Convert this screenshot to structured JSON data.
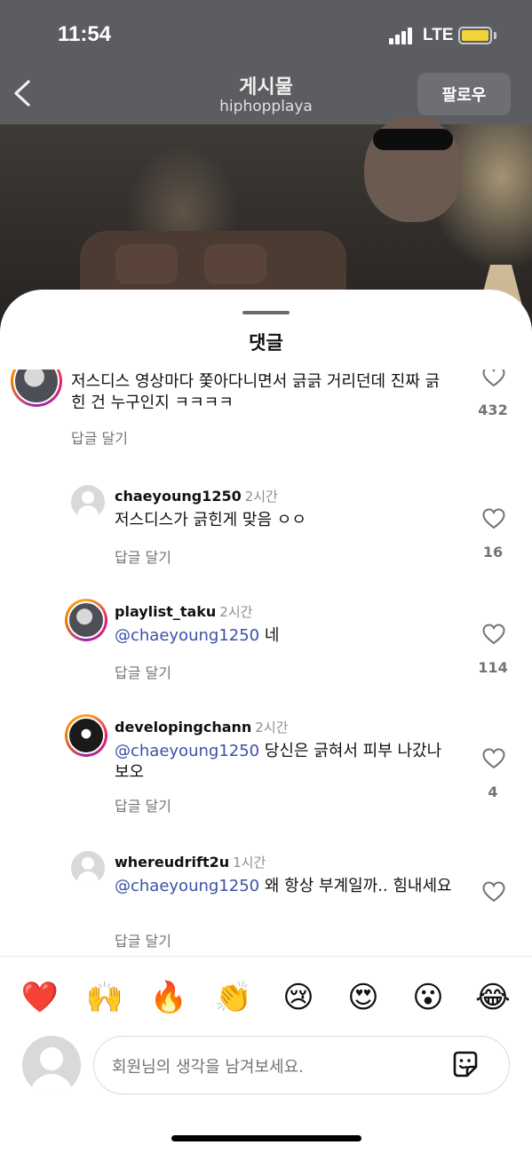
{
  "status_bar": {
    "time": "11:54",
    "network": "LTE"
  },
  "header": {
    "title": "게시물",
    "subtitle": "hiphopplaya",
    "follow_label": "팔로우"
  },
  "sheet": {
    "title": "댓글"
  },
  "comments": [
    {
      "text": "저스디스 영상마다 쫓아다니면서 긁긁 거리던데 진짜 긁힌 건 누구인지 ㅋㅋㅋㅋ",
      "reply_label": "답글 달기",
      "likes": "432"
    },
    {
      "user": "chaeyoung1250",
      "time": "2시간",
      "text": "저스디스가 긁힌게 맞음 ㅇㅇ",
      "reply_label": "답글 달기",
      "likes": "16"
    },
    {
      "user": "playlist_taku",
      "time": "2시간",
      "mention": "@chaeyoung1250",
      "text": " 네",
      "reply_label": "답글 달기",
      "likes": "114"
    },
    {
      "user": "developingchann",
      "time": "2시간",
      "mention": "@chaeyoung1250",
      "text": " 당신은 긁혀서 피부 나갔나보오",
      "reply_label": "답글 달기",
      "likes": "4"
    },
    {
      "user": "whereudrift2u",
      "time": "1시간",
      "mention": "@chaeyoung1250",
      "text": " 왜 항상 부계일까.. 힘내세요",
      "reply_label": "답글 달기",
      "likes": ""
    }
  ],
  "emoji_bar": [
    "❤️",
    "🙌",
    "🔥",
    "👏",
    "😢",
    "😍",
    "😮",
    "😂"
  ],
  "composer": {
    "placeholder": "회원님의 생각을 남겨보세요."
  },
  "colors": {
    "mention": "#3b50a8",
    "battery": "#f3d33a",
    "overlay": "#5b5d60"
  }
}
